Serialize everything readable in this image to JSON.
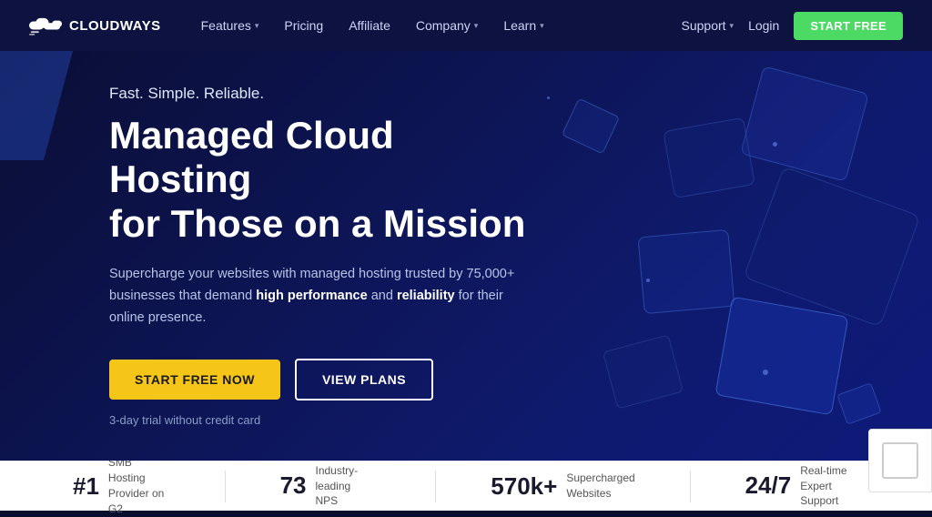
{
  "brand": {
    "name": "CLOUDWAYS",
    "logo_alt": "Cloudways logo"
  },
  "navbar": {
    "features_label": "Features",
    "pricing_label": "Pricing",
    "affiliate_label": "Affiliate",
    "company_label": "Company",
    "learn_label": "Learn",
    "support_label": "Support",
    "login_label": "Login",
    "start_free_label": "START FREE"
  },
  "hero": {
    "subtitle": "Fast. Simple. Reliable.",
    "title": "Managed Cloud Hosting\nfor Those on a Mission",
    "description_start": "Supercharge your websites with managed hosting trusted by 75,000+ businesses that demand ",
    "description_bold1": "high performance",
    "description_mid": " and ",
    "description_bold2": "reliability",
    "description_end": " for their online presence.",
    "btn_start_free": "START FREE NOW",
    "btn_view_plans": "VIEW PLANS",
    "trial_text": "3-day trial without credit card"
  },
  "stats": [
    {
      "number": "#1",
      "desc": "SMB Hosting\nProvider on G2"
    },
    {
      "number": "73",
      "desc": "Industry-leading\nNPS"
    },
    {
      "number": "570k+",
      "desc": "Supercharged\nWebsites"
    },
    {
      "number": "24/7",
      "desc": "Real-time\nExpert Support"
    }
  ]
}
